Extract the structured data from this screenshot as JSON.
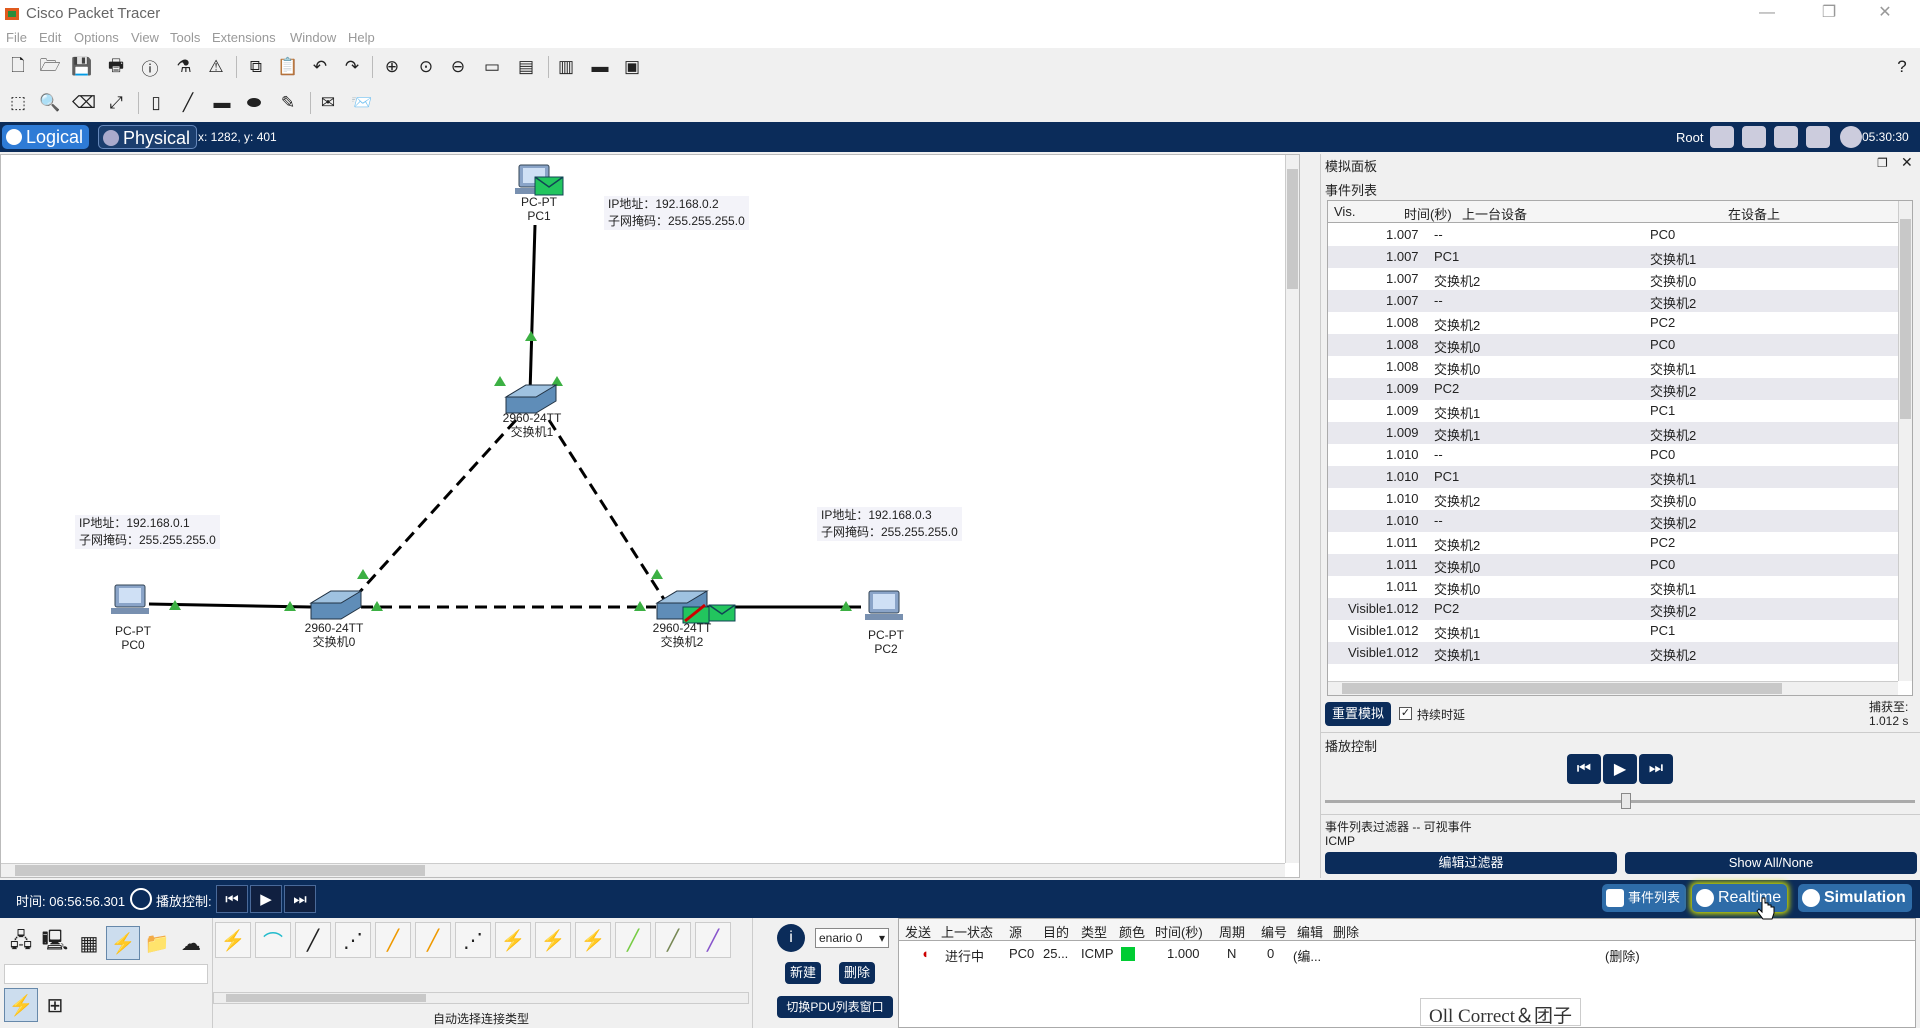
{
  "app": {
    "title": "Cisco Packet Tracer"
  },
  "menu": [
    "File",
    "Edit",
    "Options",
    "View",
    "Tools",
    "Extensions",
    "Window",
    "Help"
  ],
  "toolbar1_icons": [
    "new-file-icon",
    "open-folder-icon",
    "save-icon",
    "print-icon",
    "info-icon",
    "wizard-icon",
    "network-info-icon",
    "copy-icon",
    "paste-icon",
    "undo-icon",
    "redo-icon",
    "zoom-in-icon",
    "zoom-reset-icon",
    "zoom-out-icon",
    "drawing-palette-icon",
    "custom-device-icon",
    "cluster-icon",
    "viewport-icon",
    "environment-icon",
    "help-icon"
  ],
  "toolbar2_icons": [
    "select-icon",
    "inspect-icon",
    "delete-icon",
    "resize-icon",
    "note-icon",
    "line-icon",
    "rectangle-icon",
    "ellipse-icon",
    "freeform-icon",
    "add-simple-pdu-icon",
    "add-complex-pdu-icon"
  ],
  "workspace": {
    "logical_tab": "Logical",
    "physical_tab": "Physical",
    "coords": "x: 1282, y: 401",
    "root_label": "Root",
    "clock": "05:30:30"
  },
  "topology": {
    "devices": [
      {
        "id": "pc1",
        "type": "PC-PT",
        "name": "PC1"
      },
      {
        "id": "sw1",
        "type": "2960-24TT",
        "name": "交换机1"
      },
      {
        "id": "sw0",
        "type": "2960-24TT",
        "name": "交换机0"
      },
      {
        "id": "sw2",
        "type": "2960-24TT",
        "name": "交换机2"
      },
      {
        "id": "pc0",
        "type": "PC-PT",
        "name": "PC0"
      },
      {
        "id": "pc2",
        "type": "PC-PT",
        "name": "PC2"
      }
    ],
    "ip_notes": [
      {
        "ip": "IP地址：192.168.0.2",
        "mask": "子网掩码：255.255.255.0"
      },
      {
        "ip": "IP地址：192.168.0.1",
        "mask": "子网掩码：255.255.255.0"
      },
      {
        "ip": "IP地址：192.168.0.3",
        "mask": "子网掩码：255.255.255.0"
      }
    ],
    "link_status_color": "#3cb043",
    "envelope_color": "#22c55e"
  },
  "sim_panel": {
    "title": "模拟面板",
    "event_list_label": "事件列表",
    "columns": [
      "Vis.",
      "时间(秒)",
      "上一台设备",
      "在设备上"
    ],
    "events": [
      {
        "vis": "",
        "time": "1.007",
        "last": "--",
        "at": "PC0"
      },
      {
        "vis": "",
        "time": "1.007",
        "last": "PC1",
        "at": "交换机1"
      },
      {
        "vis": "",
        "time": "1.007",
        "last": "交换机2",
        "at": "交换机0"
      },
      {
        "vis": "",
        "time": "1.007",
        "last": "--",
        "at": "交换机2"
      },
      {
        "vis": "",
        "time": "1.008",
        "last": "交换机2",
        "at": "PC2"
      },
      {
        "vis": "",
        "time": "1.008",
        "last": "交换机0",
        "at": "PC0"
      },
      {
        "vis": "",
        "time": "1.008",
        "last": "交换机0",
        "at": "交换机1"
      },
      {
        "vis": "",
        "time": "1.009",
        "last": "PC2",
        "at": "交换机2"
      },
      {
        "vis": "",
        "time": "1.009",
        "last": "交换机1",
        "at": "PC1"
      },
      {
        "vis": "",
        "time": "1.009",
        "last": "交换机1",
        "at": "交换机2"
      },
      {
        "vis": "",
        "time": "1.010",
        "last": "--",
        "at": "PC0"
      },
      {
        "vis": "",
        "time": "1.010",
        "last": "PC1",
        "at": "交换机1"
      },
      {
        "vis": "",
        "time": "1.010",
        "last": "交换机2",
        "at": "交换机0"
      },
      {
        "vis": "",
        "time": "1.010",
        "last": "--",
        "at": "交换机2"
      },
      {
        "vis": "",
        "time": "1.011",
        "last": "交换机2",
        "at": "PC2"
      },
      {
        "vis": "",
        "time": "1.011",
        "last": "交换机0",
        "at": "PC0"
      },
      {
        "vis": "",
        "time": "1.011",
        "last": "交换机0",
        "at": "交换机1"
      },
      {
        "vis": "Visible",
        "time": "1.012",
        "last": "PC2",
        "at": "交换机2"
      },
      {
        "vis": "Visible",
        "time": "1.012",
        "last": "交换机1",
        "at": "PC1"
      },
      {
        "vis": "Visible",
        "time": "1.012",
        "last": "交换机1",
        "at": "交换机2"
      }
    ],
    "reset_button": "重置模拟",
    "constant_delay_label": "持续时延",
    "captured_label": "捕获至:",
    "captured_value": "1.012 s",
    "playback_label": "播放控制",
    "filter_label": "事件列表过滤器 -- 可视事件",
    "filter_value": "ICMP",
    "edit_filter_button": "编辑过滤器",
    "show_all_button": "Show All/None"
  },
  "bottom_bar": {
    "time_label": "时间: 06:56:56.301",
    "playback_label": "播放控制:",
    "event_list_button": "事件列表",
    "realtime_button": "Realtime",
    "simulation_button": "Simulation"
  },
  "bottom_area": {
    "auto_connect_label": "自动选择连接类型",
    "scenario_value": "enario 0",
    "new_button": "新建",
    "delete_button": "删除",
    "toggle_pdu_button": "切换PDU列表窗口",
    "pdu_columns": [
      "发送",
      "上一状态",
      "源",
      "目的",
      "类型",
      "颜色",
      "时间(秒)",
      "周期",
      "编号",
      "编辑",
      "删除"
    ],
    "pdu_row": {
      "state": "进行中",
      "src": "PC0",
      "dst": "25...",
      "type": "ICMP",
      "color": "#00cc33",
      "time": "1.000",
      "periodic": "N",
      "num": "0",
      "edit": "(编...",
      "delete": "(删除)"
    }
  },
  "watermark": "Oll Correct＆团子"
}
